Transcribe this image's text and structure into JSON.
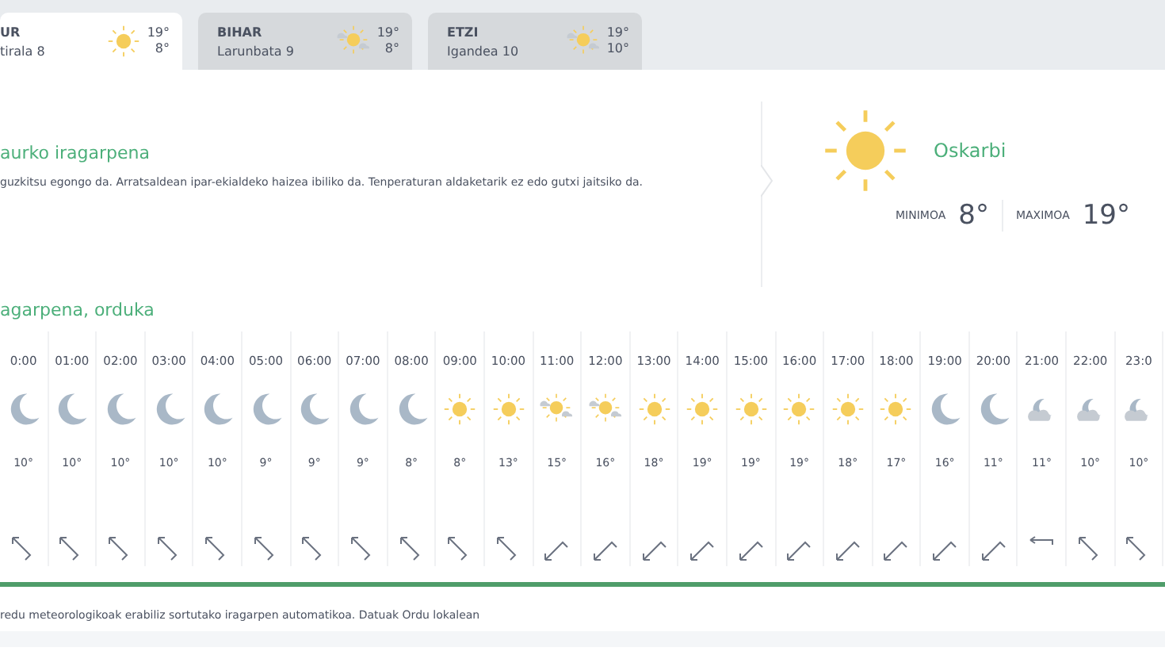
{
  "tabs": [
    {
      "label": "UR",
      "date": "tirala 8",
      "sky": {
        "kind": "sun"
      },
      "max": "19°",
      "min": "8°",
      "selected": true
    },
    {
      "label": "BIHAR",
      "date": "Larunbata 9",
      "sky": {
        "kind": "sun-cloud"
      },
      "max": "19°",
      "min": "8°",
      "selected": false
    },
    {
      "label": "ETZI",
      "date": "Igandea 10",
      "sky": {
        "kind": "sun-cloud"
      },
      "max": "19°",
      "min": "10°",
      "selected": false
    }
  ],
  "today": {
    "title": "aurko iragarpena",
    "description": "guzkitsu egongo da. Arratsaldean ipar-ekialdeko haizea ibiliko da. Tenperaturan aldaketarik ez edo gutxi jaitsiko da.",
    "sky": {
      "kind": "sun"
    },
    "condition": "Oskarbi",
    "min_label": "MINIMOA",
    "min": "8°",
    "max_label": "MAXIMOA",
    "max": "19°"
  },
  "hourly": {
    "title": "agarpena, orduka",
    "hours": [
      {
        "time": "0:00",
        "sky": {
          "kind": "moon"
        },
        "temp": "10°",
        "wind": {
          "kind": "nw"
        }
      },
      {
        "time": "01:00",
        "sky": {
          "kind": "moon"
        },
        "temp": "10°",
        "wind": {
          "kind": "nw"
        }
      },
      {
        "time": "02:00",
        "sky": {
          "kind": "moon"
        },
        "temp": "10°",
        "wind": {
          "kind": "nw"
        }
      },
      {
        "time": "03:00",
        "sky": {
          "kind": "moon"
        },
        "temp": "10°",
        "wind": {
          "kind": "nw"
        }
      },
      {
        "time": "04:00",
        "sky": {
          "kind": "moon"
        },
        "temp": "10°",
        "wind": {
          "kind": "nw"
        }
      },
      {
        "time": "05:00",
        "sky": {
          "kind": "moon"
        },
        "temp": "9°",
        "wind": {
          "kind": "nw"
        }
      },
      {
        "time": "06:00",
        "sky": {
          "kind": "moon"
        },
        "temp": "9°",
        "wind": {
          "kind": "nw"
        }
      },
      {
        "time": "07:00",
        "sky": {
          "kind": "moon"
        },
        "temp": "9°",
        "wind": {
          "kind": "nw"
        }
      },
      {
        "time": "08:00",
        "sky": {
          "kind": "moon"
        },
        "temp": "8°",
        "wind": {
          "kind": "nw"
        }
      },
      {
        "time": "09:00",
        "sky": {
          "kind": "sun"
        },
        "temp": "8°",
        "wind": {
          "kind": "nw"
        }
      },
      {
        "time": "10:00",
        "sky": {
          "kind": "sun"
        },
        "temp": "13°",
        "wind": {
          "kind": "nw"
        }
      },
      {
        "time": "11:00",
        "sky": {
          "kind": "sun-cloud"
        },
        "temp": "15°",
        "wind": {
          "kind": "sw"
        }
      },
      {
        "time": "12:00",
        "sky": {
          "kind": "sun-cloud"
        },
        "temp": "16°",
        "wind": {
          "kind": "sw"
        }
      },
      {
        "time": "13:00",
        "sky": {
          "kind": "sun"
        },
        "temp": "18°",
        "wind": {
          "kind": "sw"
        }
      },
      {
        "time": "14:00",
        "sky": {
          "kind": "sun"
        },
        "temp": "19°",
        "wind": {
          "kind": "sw"
        }
      },
      {
        "time": "15:00",
        "sky": {
          "kind": "sun"
        },
        "temp": "19°",
        "wind": {
          "kind": "sw"
        }
      },
      {
        "time": "16:00",
        "sky": {
          "kind": "sun"
        },
        "temp": "19°",
        "wind": {
          "kind": "sw"
        }
      },
      {
        "time": "17:00",
        "sky": {
          "kind": "sun"
        },
        "temp": "18°",
        "wind": {
          "kind": "sw"
        }
      },
      {
        "time": "18:00",
        "sky": {
          "kind": "sun"
        },
        "temp": "17°",
        "wind": {
          "kind": "sw"
        }
      },
      {
        "time": "19:00",
        "sky": {
          "kind": "moon"
        },
        "temp": "16°",
        "wind": {
          "kind": "sw"
        }
      },
      {
        "time": "20:00",
        "sky": {
          "kind": "moon"
        },
        "temp": "11°",
        "wind": {
          "kind": "sw"
        }
      },
      {
        "time": "21:00",
        "sky": {
          "kind": "moon-cloud"
        },
        "temp": "11°",
        "wind": {
          "kind": "w"
        }
      },
      {
        "time": "22:00",
        "sky": {
          "kind": "moon-cloud"
        },
        "temp": "10°",
        "wind": {
          "kind": "nw"
        }
      },
      {
        "time": "23:0",
        "sky": {
          "kind": "moon-cloud"
        },
        "temp": "10°",
        "wind": {
          "kind": "nw"
        }
      }
    ]
  },
  "footer": "redu meteorologikoak erabiliz sortutako iragarpen automatikoa. Datuak Ordu lokalean"
}
